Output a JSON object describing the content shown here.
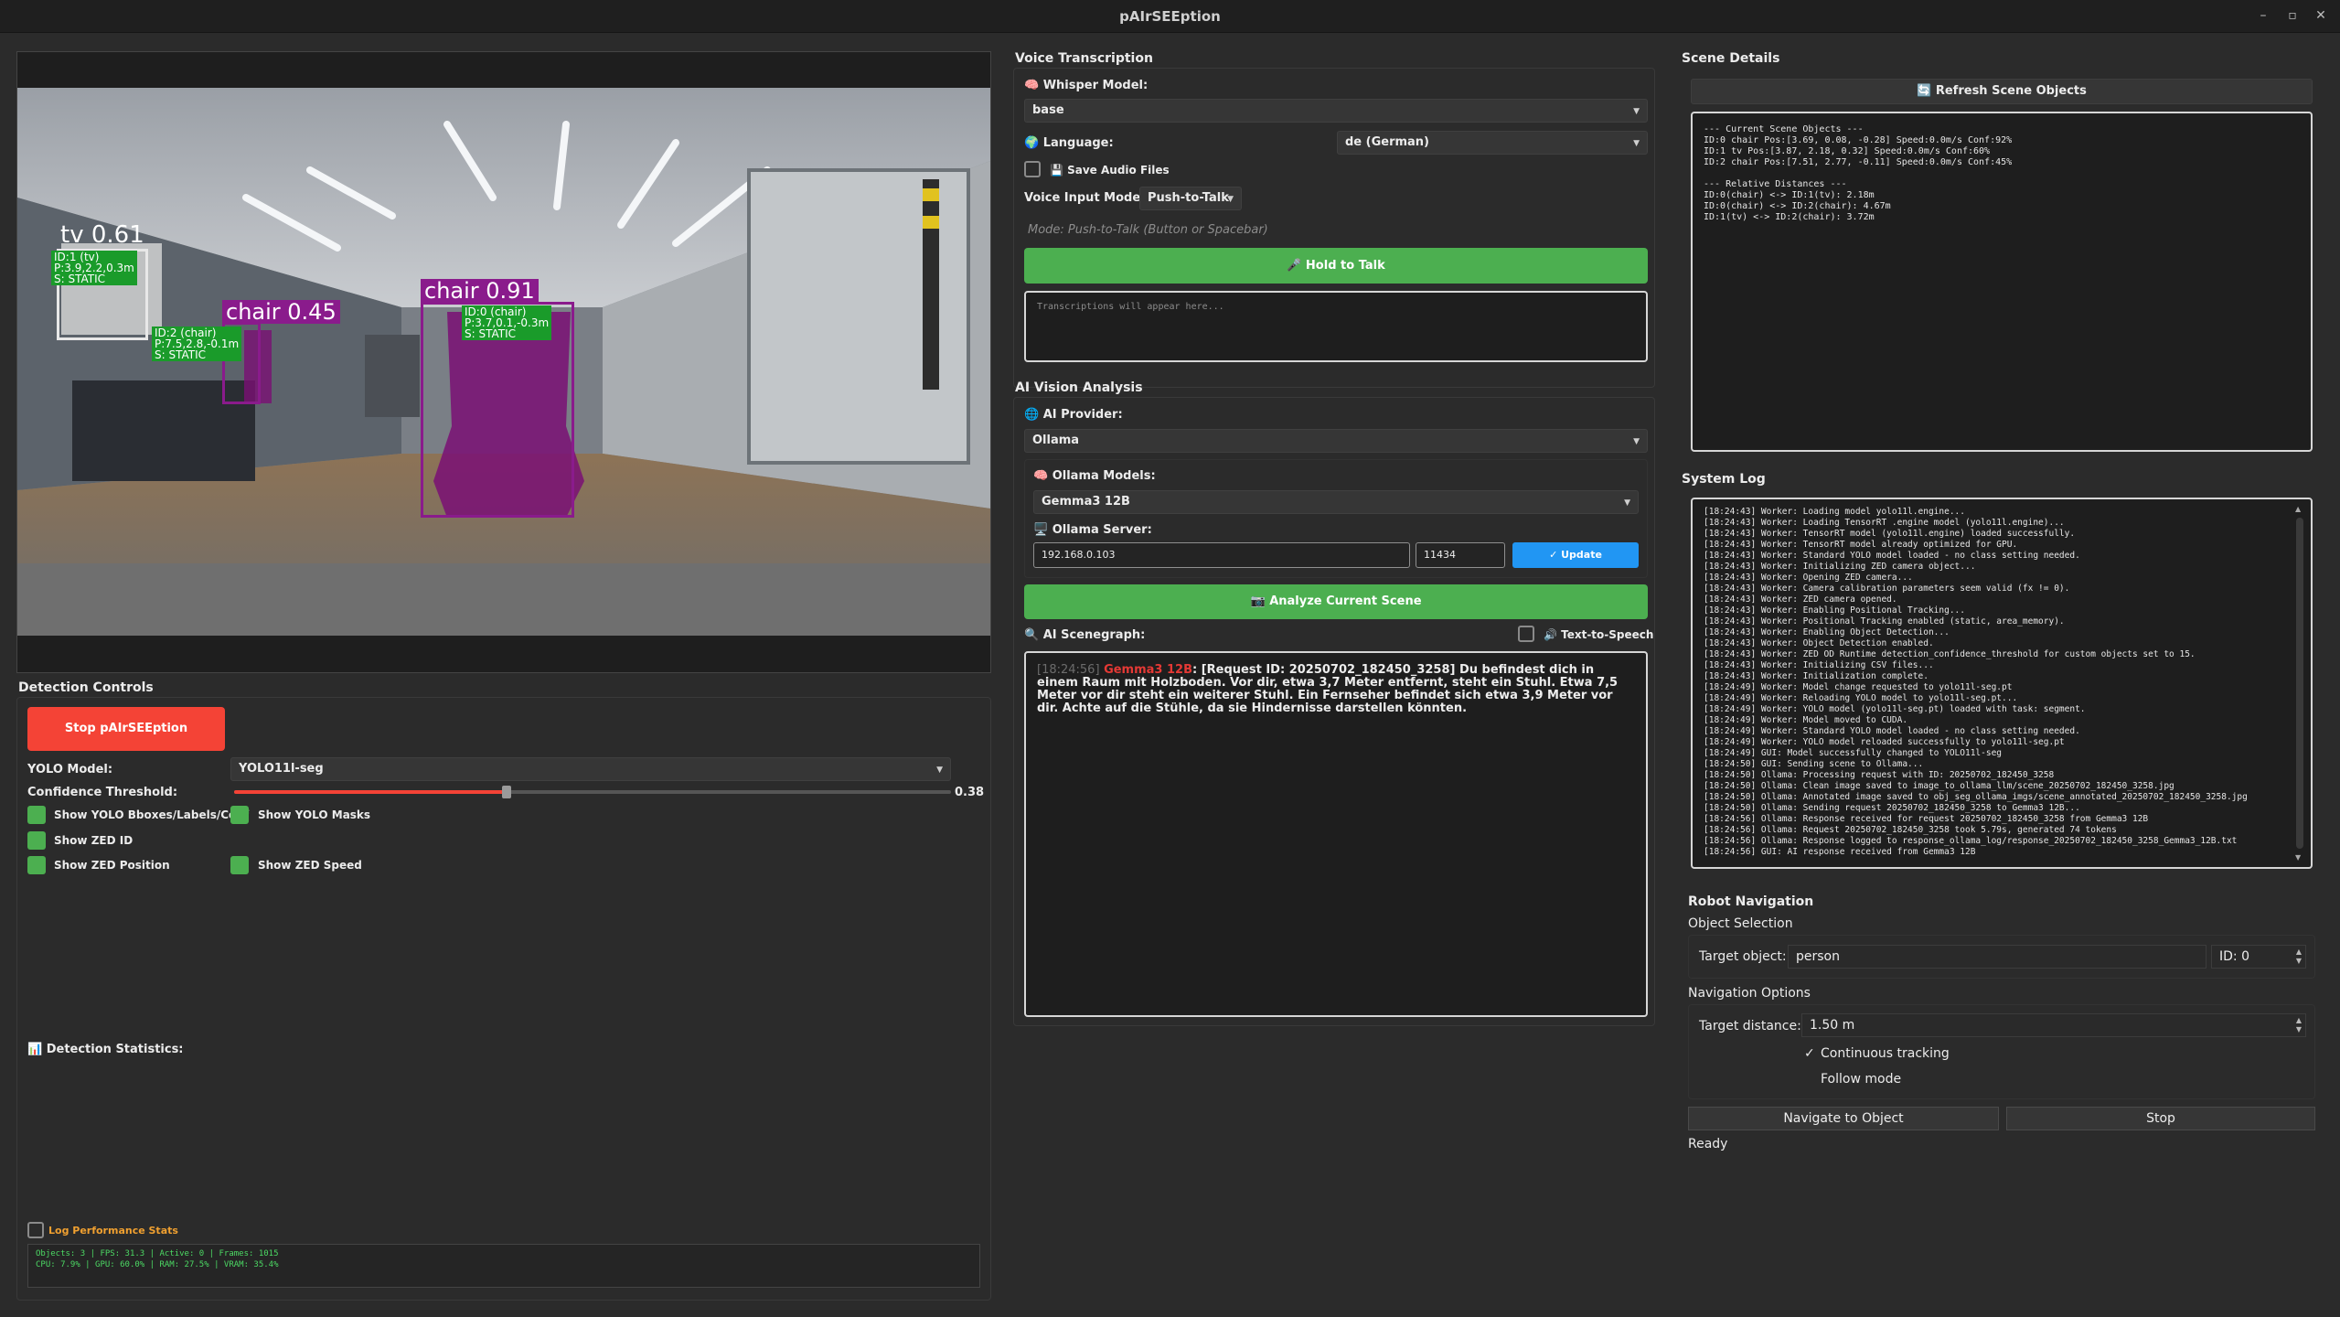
{
  "window": {
    "title": "pAIrSEEption",
    "min": "–",
    "max": "▫",
    "close": "✕"
  },
  "detections": [
    {
      "tag": "tv 0.61",
      "info": "ID:1 (tv)\nP:3.9,2.2,0.3m\nS: STATIC"
    },
    {
      "tag": "chair 0.45",
      "info": "ID:2 (chair)\nP:7.5,2.8,-0.1m\nS: STATIC"
    },
    {
      "tag": "chair 0.91",
      "info": "ID:0 (chair)\nP:3.7,0.1,-0.3m\nS: STATIC"
    }
  ],
  "detection_controls": {
    "title": "Detection Controls",
    "stop_button": "Stop pAIrSEEption",
    "yolo_model_label": "YOLO Model:",
    "yolo_model_value": "YOLO11l-seg",
    "confidence_label": "Confidence Threshold:",
    "confidence_value": "0.38",
    "confidence_fraction": 0.38,
    "checks": {
      "bboxes": "Show YOLO Bboxes/Labels/Conf",
      "masks": "Show YOLO Masks",
      "zed_id": "Show ZED ID",
      "zed_position": "Show ZED Position",
      "zed_speed": "Show ZED Speed"
    },
    "stats_title": "📊 Detection Statistics:",
    "log_perf_label": "Log Performance Stats",
    "perf_line1": "Objects: 3 | FPS: 31.3 | Active: 0 | Frames: 1015",
    "perf_line2": "CPU: 7.9% | GPU: 60.0% | RAM: 27.5% | VRAM: 35.4%"
  },
  "voice": {
    "title": "Voice Transcription",
    "whisper_label": "🧠 Whisper Model:",
    "whisper_value": "base",
    "language_label": "🌍 Language:",
    "language_value": "de (German)",
    "save_audio_label": "💾 Save Audio Files",
    "input_mode_label": "Voice Input Mode:",
    "input_mode_value": "Push-to-Talk",
    "mode_hint": "Mode: Push-to-Talk (Button or Spacebar)",
    "hold_button": "🎤 Hold to Talk",
    "transcription_placeholder": "Transcriptions will appear here..."
  },
  "ai_vision": {
    "title": "AI Vision Analysis",
    "provider_label": "🌐 AI Provider:",
    "provider_value": "Ollama",
    "models_label": "🧠 Ollama Models:",
    "models_value": "Gemma3 12B",
    "server_label": "🖥️ Ollama Server:",
    "server_ip": "192.168.0.103",
    "server_port": "11434",
    "update_button": "✓ Update",
    "analyze_button": "📷 Analyze Current Scene",
    "scenegraph_label": "🔍 AI Scenegraph:",
    "tts_label": "🔊 Text-to-Speech",
    "response_time": "[18:24:56]",
    "response_model": "Gemma3 12B",
    "response_text": ": [Request ID: 20250702_182450_3258] Du befindest dich in einem Raum mit Holzboden. Vor dir, etwa 3,7 Meter entfernt, steht ein Stuhl. Etwa 7,5 Meter vor dir steht ein weiterer Stuhl. Ein Fernseher befindet sich etwa 3,9 Meter vor dir. Achte auf die Stühle, da sie Hindernisse darstellen könnten."
  },
  "scene_details": {
    "title": "Scene Details",
    "refresh_button": "🔄 Refresh Scene Objects",
    "lines": [
      "--- Current Scene Objects ---",
      "ID:0 chair Pos:[3.69, 0.08, -0.28] Speed:0.0m/s Conf:92%",
      "ID:1 tv Pos:[3.87, 2.18, 0.32] Speed:0.0m/s Conf:60%",
      "ID:2 chair Pos:[7.51, 2.77, -0.11] Speed:0.0m/s Conf:45%",
      "",
      "--- Relative Distances ---",
      "ID:0(chair) <-> ID:1(tv): 2.18m",
      "ID:0(chair) <-> ID:2(chair): 4.67m",
      "ID:1(tv) <-> ID:2(chair): 3.72m"
    ]
  },
  "system_log": {
    "title": "System Log",
    "lines": [
      "[18:24:43] Worker: Loading model yolo11l.engine...",
      "[18:24:43] Worker: Loading TensorRT .engine model (yolo11l.engine)...",
      "[18:24:43] Worker: TensorRT model (yolo11l.engine) loaded successfully.",
      "[18:24:43] Worker: TensorRT model already optimized for GPU.",
      "[18:24:43] Worker: Standard YOLO model loaded - no class setting needed.",
      "[18:24:43] Worker: Initializing ZED camera object...",
      "[18:24:43] Worker: Opening ZED camera...",
      "[18:24:43] Worker: Camera calibration parameters seem valid (fx != 0).",
      "[18:24:43] Worker: ZED camera opened.",
      "[18:24:43] Worker: Enabling Positional Tracking...",
      "[18:24:43] Worker: Positional Tracking enabled (static, area_memory).",
      "[18:24:43] Worker: Enabling Object Detection...",
      "[18:24:43] Worker: Object Detection enabled.",
      "[18:24:43] Worker: ZED OD Runtime detection_confidence_threshold for custom objects set to 15.",
      "[18:24:43] Worker: Initializing CSV files...",
      "[18:24:43] Worker: Initialization complete.",
      "[18:24:49] Worker: Model change requested to yolo11l-seg.pt",
      "[18:24:49] Worker: Reloading YOLO model to yolo11l-seg.pt...",
      "[18:24:49] Worker: YOLO model (yolo11l-seg.pt) loaded with task: segment.",
      "[18:24:49] Worker: Model moved to CUDA.",
      "[18:24:49] Worker: Standard YOLO model loaded - no class setting needed.",
      "[18:24:49] Worker: YOLO model reloaded successfully to yolo11l-seg.pt",
      "[18:24:49] GUI: Model successfully changed to YOLO11l-seg",
      "[18:24:50] GUI: Sending scene to Ollama...",
      "[18:24:50] Ollama: Processing request with ID: 20250702_182450_3258",
      "[18:24:50] Ollama: Clean image saved to image_to_ollama_llm/scene_20250702_182450_3258.jpg",
      "[18:24:50] Ollama: Annotated image saved to obj_seg_ollama_imgs/scene_annotated_20250702_182450_3258.jpg",
      "[18:24:50] Ollama: Sending request 20250702_182450_3258 to Gemma3 12B...",
      "[18:24:56] Ollama: Response received for request 20250702_182450_3258 from Gemma3 12B",
      "[18:24:56] Ollama: Request 20250702_182450_3258 took 5.79s, generated 74 tokens",
      "[18:24:56] Ollama: Response logged to response_ollama_log/response_20250702_182450_3258_Gemma3_12B.txt",
      "[18:24:56] GUI: AI response received from Gemma3 12B"
    ]
  },
  "robot_nav": {
    "title": "Robot Navigation",
    "object_selection": "Object Selection",
    "target_object_label": "Target object:",
    "target_object_value": "person",
    "id_value": "ID: 0",
    "nav_options": "Navigation Options",
    "target_distance_label": "Target distance:",
    "target_distance_value": "1.50 m",
    "continuous_check": "✓",
    "continuous_label": "Continuous tracking",
    "follow_label": "Follow mode",
    "navigate_button": "Navigate to Object",
    "stop_button": "Stop",
    "status": "Ready"
  }
}
